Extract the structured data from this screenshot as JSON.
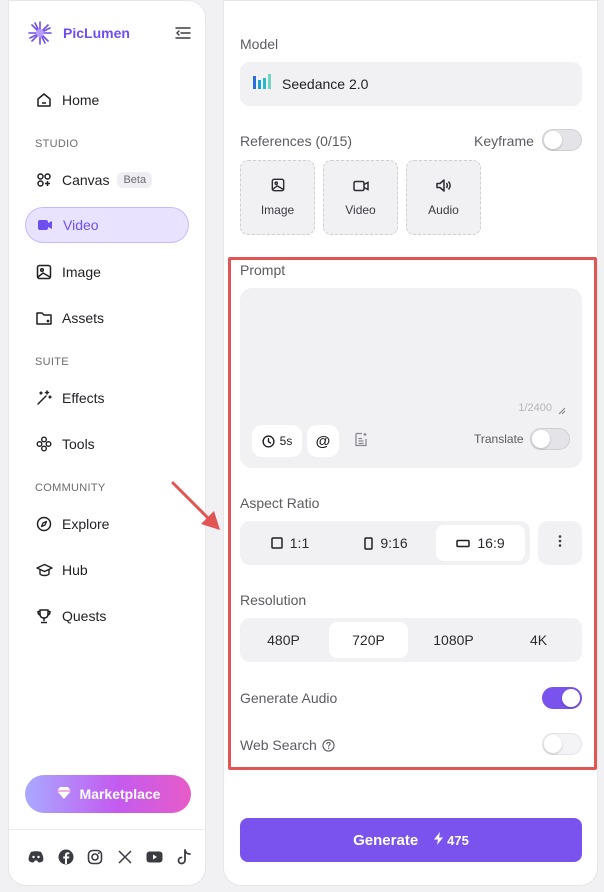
{
  "brand": {
    "name": "PicLumen"
  },
  "sidebar": {
    "items": [
      {
        "label": "Home",
        "icon": "home-icon"
      },
      {
        "label": "Canvas",
        "badge": "Beta",
        "icon": "canvas-icon"
      },
      {
        "label": "Video",
        "icon": "video-camera-icon",
        "active": true
      },
      {
        "label": "Image",
        "icon": "image-icon"
      },
      {
        "label": "Assets",
        "icon": "folder-icon"
      },
      {
        "label": "Effects",
        "icon": "magic-wand-icon"
      },
      {
        "label": "Tools",
        "icon": "tools-icon"
      },
      {
        "label": "Explore",
        "icon": "compass-icon"
      },
      {
        "label": "Hub",
        "icon": "graduation-cap-icon"
      },
      {
        "label": "Quests",
        "icon": "trophy-icon"
      }
    ],
    "sections": {
      "studio": "STUDIO",
      "suite": "SUITE",
      "community": "COMMUNITY"
    },
    "marketplace": "Marketplace",
    "socials": [
      "discord-icon",
      "facebook-icon",
      "instagram-icon",
      "x-icon",
      "youtube-icon",
      "tiktok-icon"
    ]
  },
  "model": {
    "label": "Model",
    "value": "Seedance 2.0"
  },
  "references": {
    "label": "References (0/15)",
    "keyframe_label": "Keyframe",
    "keyframe_on": false,
    "cards": [
      {
        "label": "Image",
        "icon": "image-icon"
      },
      {
        "label": "Video",
        "icon": "video-camera-icon"
      },
      {
        "label": "Audio",
        "icon": "speaker-icon"
      }
    ]
  },
  "prompt": {
    "label": "Prompt",
    "counter": "1/2400",
    "duration": "5s",
    "mention": "@",
    "translate_label": "Translate",
    "translate_on": false
  },
  "aspect_ratio": {
    "label": "Aspect Ratio",
    "options": [
      "1:1",
      "9:16",
      "16:9"
    ],
    "selected": "16:9"
  },
  "resolution": {
    "label": "Resolution",
    "options": [
      "480P",
      "720P",
      "1080P",
      "4K"
    ],
    "selected": "720P"
  },
  "generate_audio": {
    "label": "Generate Audio",
    "on": true
  },
  "web_search": {
    "label": "Web Search",
    "on": false
  },
  "generate": {
    "label": "Generate",
    "cost": "475"
  },
  "colors": {
    "accent": "#7a52ee",
    "highlight": "#e25555",
    "brand": "#6f4ef0"
  }
}
